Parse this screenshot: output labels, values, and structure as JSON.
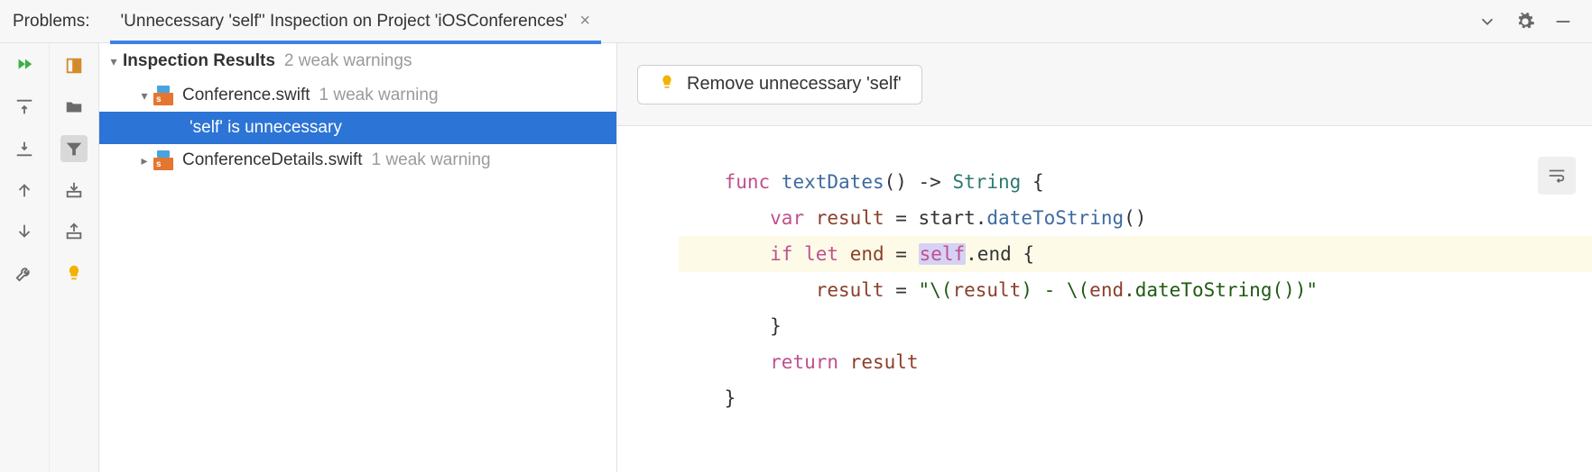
{
  "header": {
    "problems_label": "Problems:",
    "tab_title": "'Unnecessary 'self'' Inspection on Project 'iOSConferences'"
  },
  "tree": {
    "title": "Inspection Results",
    "title_summary": "2 weak warnings",
    "nodes": [
      {
        "file": "Conference.swift",
        "summary": "1 weak warning",
        "expanded": true,
        "children": [
          {
            "label": "'self' is unnecessary",
            "selected": true
          }
        ]
      },
      {
        "file": "ConferenceDetails.swift",
        "summary": "1 weak warning",
        "expanded": false
      }
    ]
  },
  "action": {
    "fix_label": "Remove unnecessary 'self'"
  },
  "code": {
    "line1": {
      "kw": "func",
      "name": "textDates",
      "sig": "() -> ",
      "type": "String",
      "brace": " {"
    },
    "line2": {
      "kw": "var",
      "name": "result",
      "eq": " = start.",
      "call": "dateToString",
      "rest": "()"
    },
    "line3": {
      "kw1": "if",
      "kw2": "let",
      "name": "end",
      "eq": " = ",
      "self": "self",
      "rest": ".end {"
    },
    "line4": {
      "name": "result",
      "eq": " = ",
      "s1": "\"\\(",
      "r": "result",
      "s2": ") - \\(",
      "e": "end",
      "s3": ".dateToString())\""
    },
    "line5": "        }",
    "line6": {
      "kw": "return",
      "name": "result"
    },
    "line7": "    }"
  }
}
